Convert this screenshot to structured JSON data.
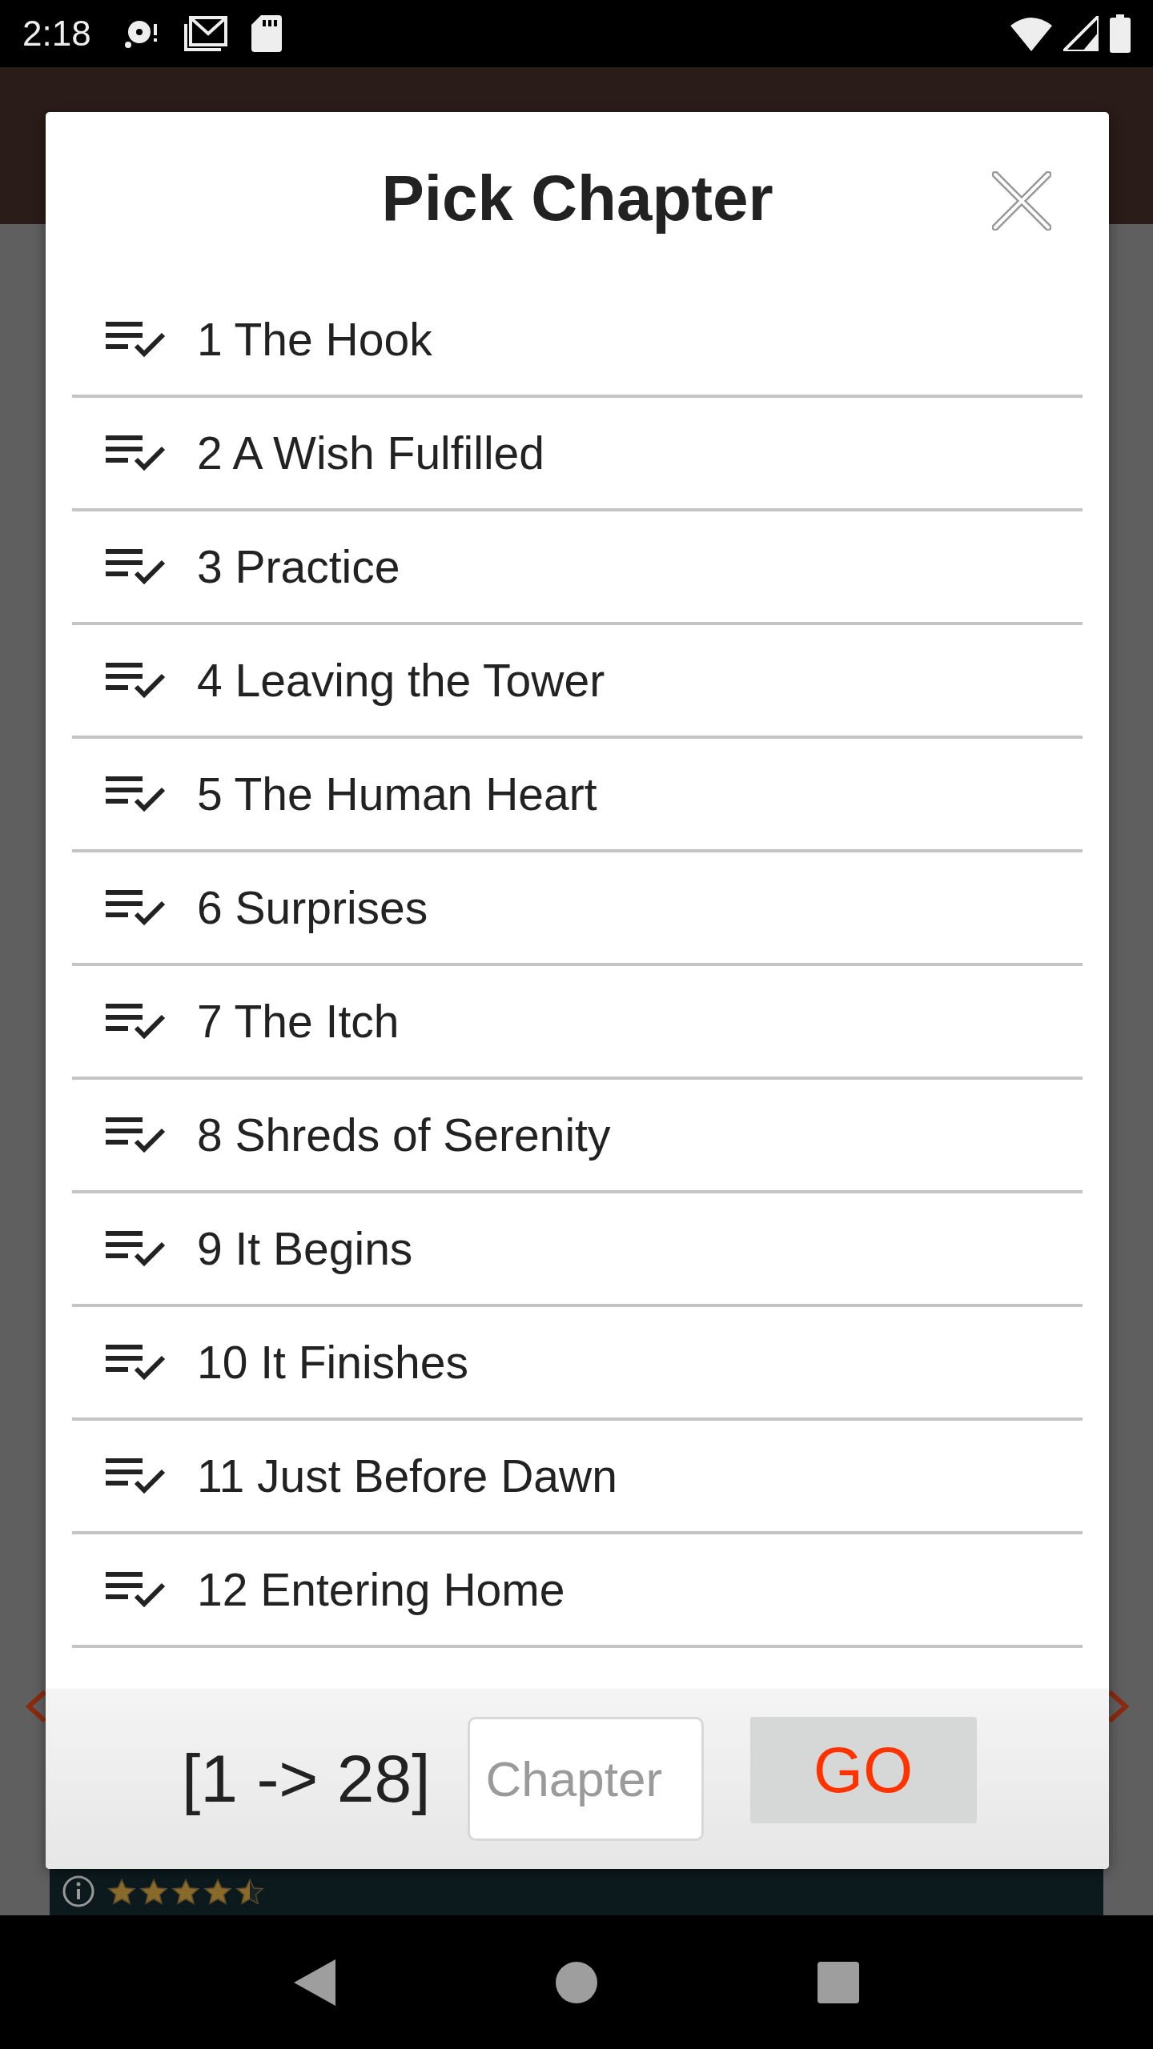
{
  "status_bar": {
    "time": "2:18"
  },
  "dialog": {
    "title": "Pick Chapter",
    "chapters": [
      {
        "label": "1 The Hook"
      },
      {
        "label": "2 A Wish Fulfilled"
      },
      {
        "label": "3 Practice"
      },
      {
        "label": "4 Leaving the Tower"
      },
      {
        "label": "5 The Human Heart"
      },
      {
        "label": "6 Surprises"
      },
      {
        "label": "7 The Itch"
      },
      {
        "label": "8 Shreds of Serenity"
      },
      {
        "label": "9 It Begins"
      },
      {
        "label": "10 It Finishes"
      },
      {
        "label": "11 Just Before Dawn"
      },
      {
        "label": "12 Entering Home"
      }
    ],
    "range": "[1 -> 28]",
    "chapter_field": {
      "placeholder": "Chapter"
    },
    "go_button": "GO"
  },
  "ad": {
    "stars": 4.5
  }
}
